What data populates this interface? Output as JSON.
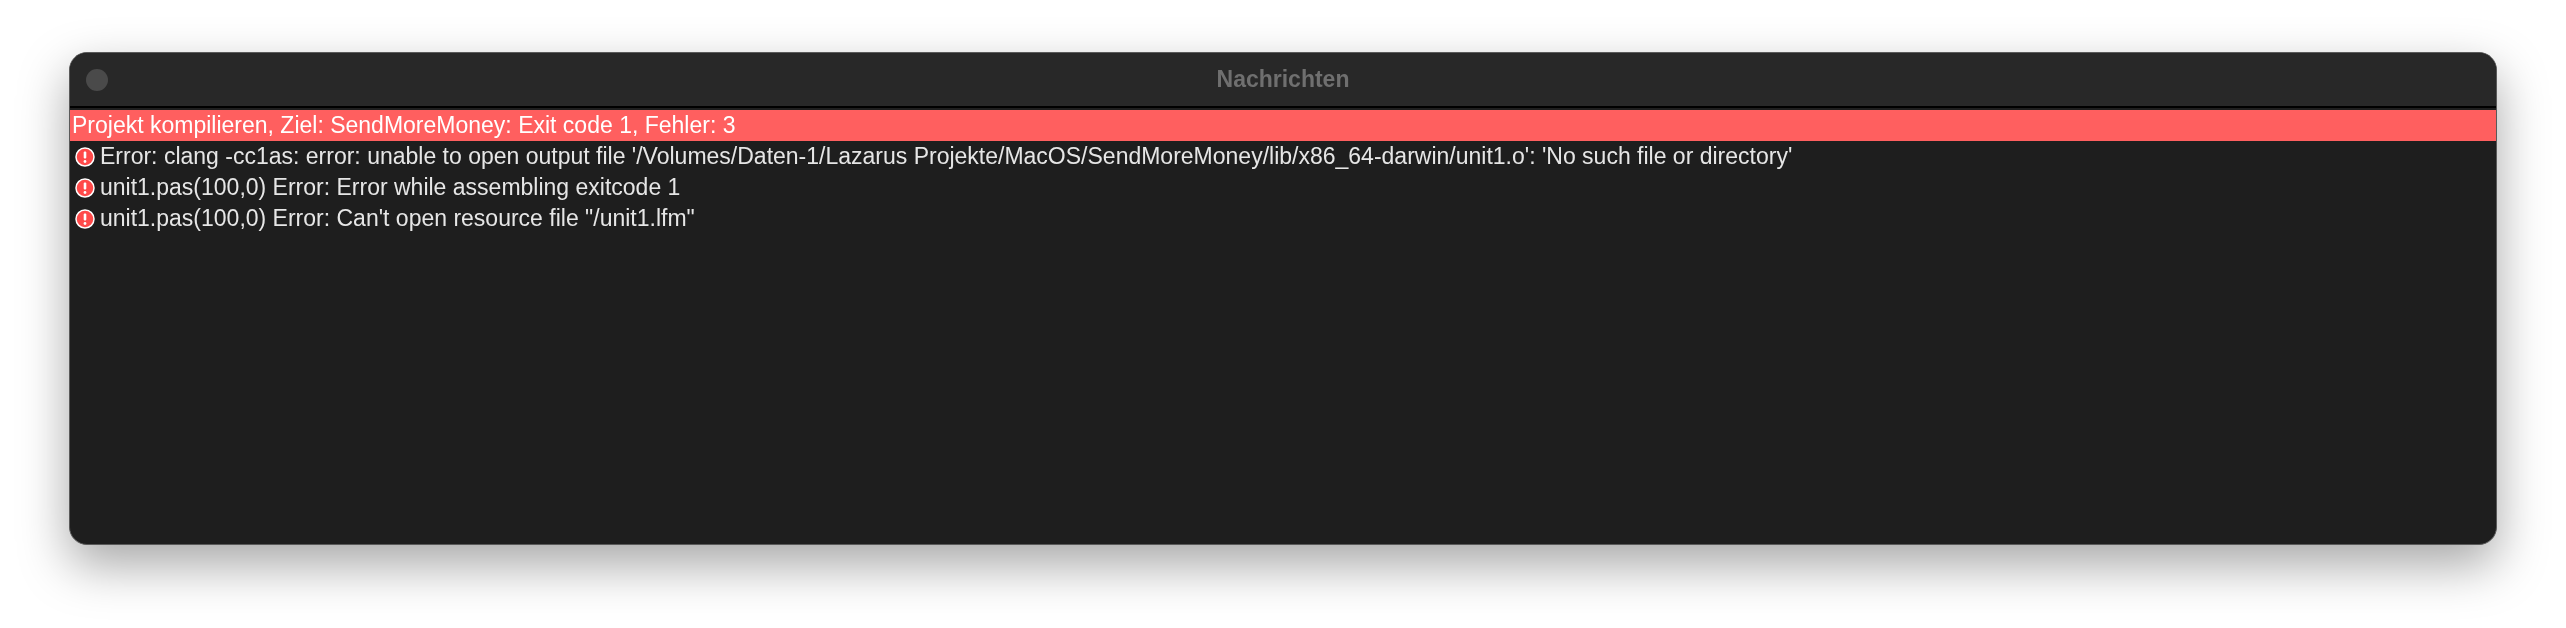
{
  "window": {
    "title": "Nachrichten"
  },
  "messages": [
    {
      "kind": "summary",
      "text": "Projekt kompilieren, Ziel: SendMoreMoney: Exit code 1, Fehler: 3"
    },
    {
      "kind": "error",
      "text": "Error: clang -cc1as: error: unable to open output file '/Volumes/Daten-1/Lazarus Projekte/MacOS/SendMoreMoney/lib/x86_64-darwin/unit1.o': 'No such file or directory'"
    },
    {
      "kind": "error",
      "text": "unit1.pas(100,0) Error: Error while assembling exitcode 1"
    },
    {
      "kind": "error",
      "text": "unit1.pas(100,0) Error: Can't open resource file \"/unit1.lfm\""
    }
  ]
}
